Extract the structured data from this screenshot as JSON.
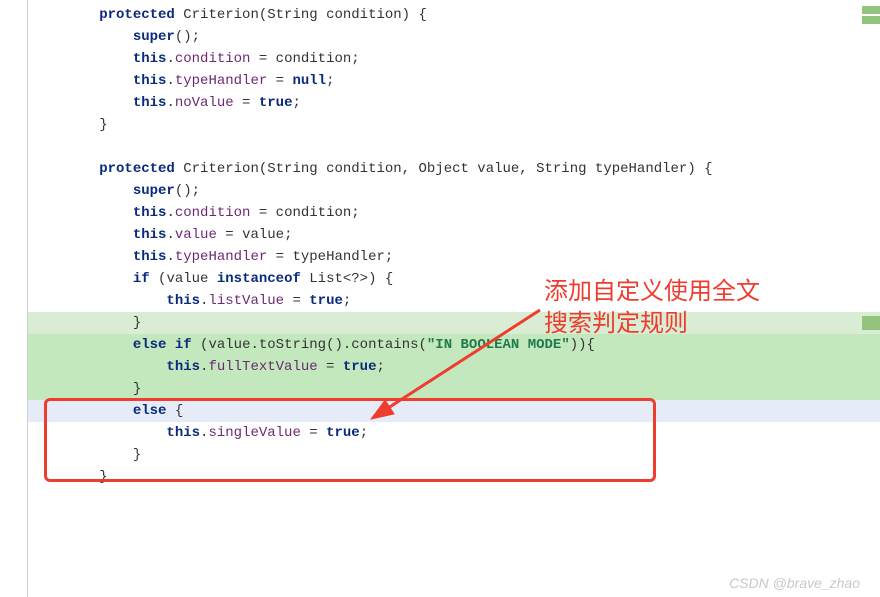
{
  "code": {
    "l1": "        protected Criterion(String condition) {",
    "l2": "            super();",
    "l3": "            this.condition = condition;",
    "l4": "            this.typeHandler = null;",
    "l5": "            this.noValue = true;",
    "l6": "        }",
    "l7": "",
    "l8": "        protected Criterion(String condition, Object value, String typeHandler) {",
    "l9": "            super();",
    "l10": "            this.condition = condition;",
    "l11": "            this.value = value;",
    "l12": "            this.typeHandler = typeHandler;",
    "l13": "            if (value instanceof List<?>) {",
    "l14": "                this.listValue = true;",
    "l15": "            }",
    "l16": "            else if (value.toString().contains(\"IN BOOLEAN MODE\")){",
    "l17": "                this.fullTextValue = true;",
    "l18": "            }",
    "l19": "            else {",
    "l20": "                this.singleValue = true;",
    "l21": "            }",
    "l22": "        }"
  },
  "tokens": {
    "protected": "protected",
    "super": "super",
    "this": "this",
    "null": "null",
    "true": "true",
    "if": "if",
    "else": "else",
    "instanceof": "instanceof",
    "condition": "condition",
    "typeHandler": "typeHandler",
    "noValue": "noValue",
    "value": "value",
    "listValue": "listValue",
    "fullTextValue": "fullTextValue",
    "singleValue": "singleValue",
    "str_boolean_mode": "\"IN BOOLEAN MODE\""
  },
  "annotation": {
    "line1": "添加自定义使用全文",
    "line2": "搜索判定规则"
  },
  "watermark": "CSDN @brave_zhao"
}
